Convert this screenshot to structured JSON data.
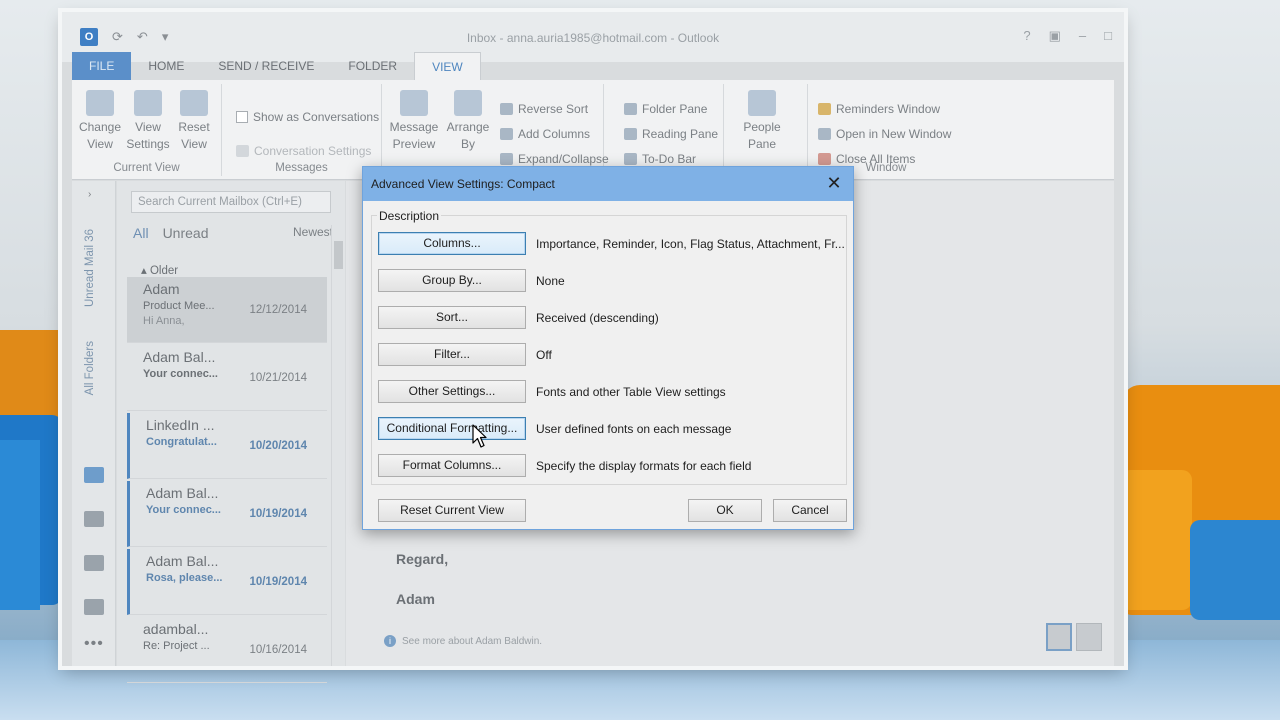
{
  "window": {
    "title": "Inbox - anna.auria1985@hotmail.com - Outlook",
    "tabs": [
      "FILE",
      "HOME",
      "SEND / RECEIVE",
      "FOLDER",
      "VIEW"
    ]
  },
  "ribbon": {
    "current_view": {
      "label": "Current View",
      "change_view": "Change View",
      "view_settings": "View Settings",
      "reset_view": "Reset View"
    },
    "messages": {
      "label": "Messages",
      "show_as_conversations": "Show as Conversations",
      "conversation_settings": "Conversation Settings"
    },
    "arrangement": {
      "message_preview": "Message Preview",
      "arrange_by": "Arrange By",
      "reverse_sort": "Reverse Sort",
      "add_columns": "Add Columns",
      "expand_collapse": "Expand/Collapse"
    },
    "layout": {
      "folder_pane": "Folder Pane",
      "reading_pane": "Reading Pane",
      "to_do_bar": "To-Do Bar"
    },
    "people_pane": "People Pane",
    "window": {
      "label": "Window",
      "reminders_window": "Reminders Window",
      "open_in_new_window": "Open in New Window",
      "close_all_items": "Close All Items"
    }
  },
  "nav": {
    "unread_mail": "Unread Mail",
    "unread_count": "36",
    "all_folders": "All Folders"
  },
  "message_list": {
    "search_placeholder": "Search Current Mailbox (Ctrl+E)",
    "filter_all": "All",
    "filter_unread": "Unread",
    "sort": "Newest",
    "group": "Older",
    "messages": [
      {
        "from": "Adam",
        "subject": "Product Mee...",
        "date": "12/12/2014",
        "preview": "Hi Anna,"
      },
      {
        "from": "Adam Bal...",
        "subject": "Your connec...",
        "date": "10/21/2014",
        "preview": ""
      },
      {
        "from": "LinkedIn ...",
        "subject": "Congratulat...",
        "date": "10/20/2014",
        "preview": ""
      },
      {
        "from": "Adam Bal...",
        "subject": "Your connec...",
        "date": "10/19/2014",
        "preview": ""
      },
      {
        "from": "Adam Bal...",
        "subject": "Rosa, please...",
        "date": "10/19/2014",
        "preview": ""
      },
      {
        "from": "adambal...",
        "subject": "Re: Project ...",
        "date": "10/16/2014",
        "preview": ""
      }
    ]
  },
  "reading_pane": {
    "regard": "Regard,",
    "signature": "Adam",
    "see_more": "See more about Adam Baldwin."
  },
  "dialog": {
    "title": "Advanced View Settings: Compact",
    "group_label": "Description",
    "rows": [
      {
        "button": "Columns...",
        "value": "Importance, Reminder, Icon, Flag Status, Attachment, Fr..."
      },
      {
        "button": "Group By...",
        "value": "None"
      },
      {
        "button": "Sort...",
        "value": "Received (descending)"
      },
      {
        "button": "Filter...",
        "value": "Off"
      },
      {
        "button": "Other Settings...",
        "value": "Fonts and other Table View settings"
      },
      {
        "button": "Conditional Formatting...",
        "value": "User defined fonts on each message"
      },
      {
        "button": "Format Columns...",
        "value": "Specify the display formats for each field"
      }
    ],
    "reset_label": "Reset Current View",
    "ok_label": "OK",
    "cancel_label": "Cancel"
  }
}
